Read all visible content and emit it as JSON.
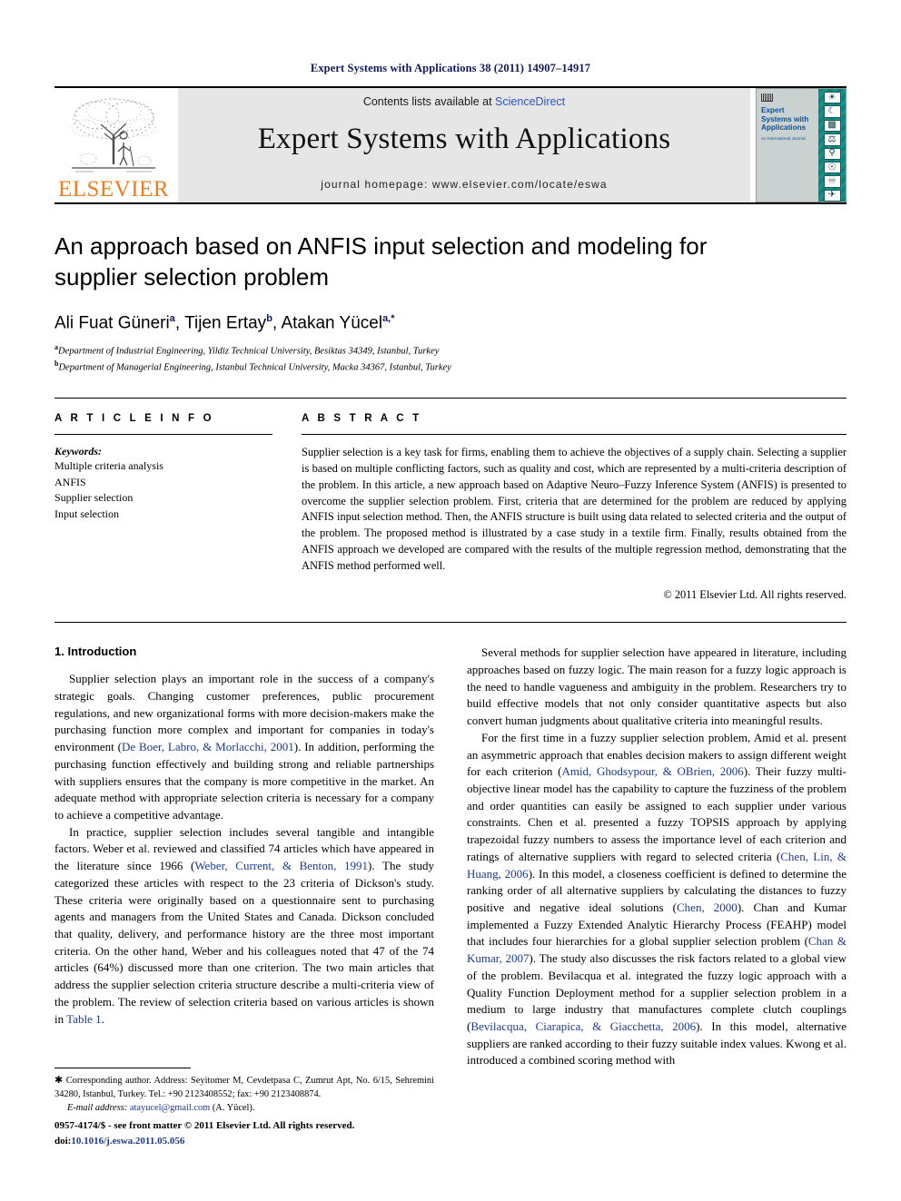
{
  "running_head": "Expert Systems with Applications 38 (2011) 14907–14917",
  "masthead": {
    "publisher_name": "ELSEVIER",
    "contents_prefix": "Contents lists available at ",
    "contents_link": "ScienceDirect",
    "journal_title": "Expert Systems with Applications",
    "homepage": "journal homepage: www.elsevier.com/locate/eswa",
    "cover": {
      "title": "Expert Systems with Applications",
      "subtitle": "An International Journal",
      "icons": [
        "globe-icon",
        "moon-icon",
        "bar-chart-icon",
        "scales-icon",
        "microscope-icon",
        "satellite-icon",
        "flask-icon",
        "aircraft-icon"
      ]
    }
  },
  "article": {
    "title": "An approach based on ANFIS input selection and modeling for supplier selection problem",
    "authors": [
      {
        "name": "Ali Fuat Güneri",
        "marks": "a"
      },
      {
        "name": "Tijen Ertay",
        "marks": "b"
      },
      {
        "name": "Atakan Yücel",
        "marks": "a,*"
      }
    ],
    "authors_line": "Ali Fuat Güneri a, Tijen Ertay b, Atakan Yücel a,*",
    "affiliations": [
      {
        "mark": "a",
        "text": "Department of Industrial Engineering, Yildiz Technical University, Besiktas 34349, Istanbul, Turkey"
      },
      {
        "mark": "b",
        "text": "Department of Managerial Engineering, Istanbul Technical University, Macka 34367, Istanbul, Turkey"
      }
    ]
  },
  "article_info": {
    "heading": "A R T I C L E   I N F O",
    "keywords_label": "Keywords:",
    "keywords": [
      "Multiple criteria analysis",
      "ANFIS",
      "Supplier selection",
      "Input selection"
    ]
  },
  "abstract": {
    "heading": "A B S T R A C T",
    "text": "Supplier selection is a key task for firms, enabling them to achieve the objectives of a supply chain. Selecting a supplier is based on multiple conflicting factors, such as quality and cost, which are represented by a multi-criteria description of the problem. In this article, a new approach based on Adaptive Neuro–Fuzzy Inference System (ANFIS) is presented to overcome the supplier selection problem. First, criteria that are determined for the problem are reduced by applying ANFIS input selection method. Then, the ANFIS structure is built using data related to selected criteria and the output of the problem. The proposed method is illustrated by a case study in a textile firm. Finally, results obtained from the ANFIS approach we developed are compared with the results of the multiple regression method, demonstrating that the ANFIS method performed well.",
    "copyright": "© 2011 Elsevier Ltd. All rights reserved."
  },
  "body": {
    "section_title": "1. Introduction",
    "left_paragraphs": [
      "Supplier selection plays an important role in the success of a company's strategic goals. Changing customer preferences, public procurement regulations, and new organizational forms with more decision-makers make the purchasing function more complex and important for companies in today's environment (De Boer, Labro, & Morlacchi, 2001). In addition, performing the purchasing function effectively and building strong and reliable partnerships with suppliers ensures that the company is more competitive in the market. An adequate method with appropriate selection criteria is necessary for a company to achieve a competitive advantage.",
      "In practice, supplier selection includes several tangible and intangible factors. Weber et al. reviewed and classified 74 articles which have appeared in the literature since 1966 (Weber, Current, & Benton, 1991). The study categorized these articles with respect to the 23 criteria of Dickson's study. These criteria were originally based on a questionnaire sent to purchasing agents and managers from the United States and Canada. Dickson concluded that quality, delivery, and performance history are the three most important criteria. On the other hand, Weber and his colleagues noted that 47 of the 74 articles (64%) discussed more than one criterion. The two main articles that address the supplier selection criteria structure describe a multi-criteria view of the problem. The review of selection criteria based on various articles is shown in Table 1."
    ],
    "right_paragraphs": [
      "Several methods for supplier selection have appeared in literature, including approaches based on fuzzy logic. The main reason for a fuzzy logic approach is the need to handle vagueness and ambiguity in the problem. Researchers try to build effective models that not only consider quantitative aspects but also convert human judgments about qualitative criteria into meaningful results.",
      "For the first time in a fuzzy supplier selection problem, Amid et al. present an asymmetric approach that enables decision makers to assign different weight for each criterion (Amid, Ghodsypour, & OBrien, 2006). Their fuzzy multi-objective linear model has the capability to capture the fuzziness of the problem and order quantities can easily be assigned to each supplier under various constraints. Chen et al. presented a fuzzy TOPSIS approach by applying trapezoidal fuzzy numbers to assess the importance level of each criterion and ratings of alternative suppliers with regard to selected criteria (Chen, Lin, & Huang, 2006). In this model, a closeness coefficient is defined to determine the ranking order of all alternative suppliers by calculating the distances to fuzzy positive and negative ideal solutions (Chen, 2000). Chan and Kumar implemented a Fuzzy Extended Analytic Hierarchy Process (FEAHP) model that includes four hierarchies for a global supplier selection problem (Chan & Kumar, 2007). The study also discusses the risk factors related to a global view of the problem. Bevilacqua et al. integrated the fuzzy logic approach with a Quality Function Deployment method for a supplier selection problem in a medium to large industry that manufactures complete clutch couplings (Bevilacqua, Ciarapica, & Giacchetta, 2006). In this model, alternative suppliers are ranked according to their fuzzy suitable index values. Kwong et al. introduced a combined scoring method with"
    ]
  },
  "footnotes": {
    "corresponding": "Corresponding author. Address: Seyitomer M, Cevdetpasa C, Zumrut Apt, No. 6/15, Sehremini 34280, Istanbul, Turkey. Tel.: +90 2123408552; fax: +90 2123408874.",
    "email_label": "E-mail address:",
    "email": "atayucel@gmail.com",
    "email_suffix": "(A. Yücel)."
  },
  "footer": {
    "issn_line": "0957-4174/$ - see front matter © 2011 Elsevier Ltd. All rights reserved.",
    "doi_label": "doi:",
    "doi": "10.1016/j.eswa.2011.05.056"
  },
  "colors": {
    "running_head": "#111a5c",
    "elsevier_orange": "#f07c22",
    "sciencedirect_blue": "#2b56c6",
    "citation_blue": "#1b3a8c",
    "band_gray": "#e6e6e6",
    "cover_teal": "#14807a"
  }
}
